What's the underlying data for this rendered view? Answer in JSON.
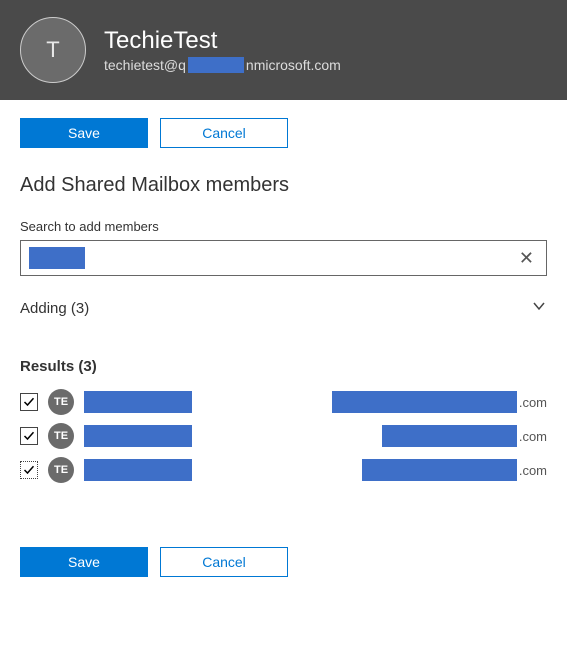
{
  "header": {
    "avatar_initial": "T",
    "title": "TechieTest",
    "email_prefix": "techietest@q",
    "email_suffix": "nmicrosoft.com"
  },
  "buttons": {
    "save": "Save",
    "cancel": "Cancel"
  },
  "section_title": "Add Shared Mailbox members",
  "search": {
    "label": "Search to add members",
    "value": ""
  },
  "adding": {
    "label": "Adding (3)"
  },
  "results": {
    "label": "Results (3)",
    "rows": [
      {
        "initials": "TE",
        "email_suffix": ".com",
        "email_redact_w": 185
      },
      {
        "initials": "TE",
        "email_suffix": ".com",
        "email_redact_w": 135
      },
      {
        "initials": "TE",
        "email_suffix": ".com",
        "email_redact_w": 155
      }
    ]
  }
}
